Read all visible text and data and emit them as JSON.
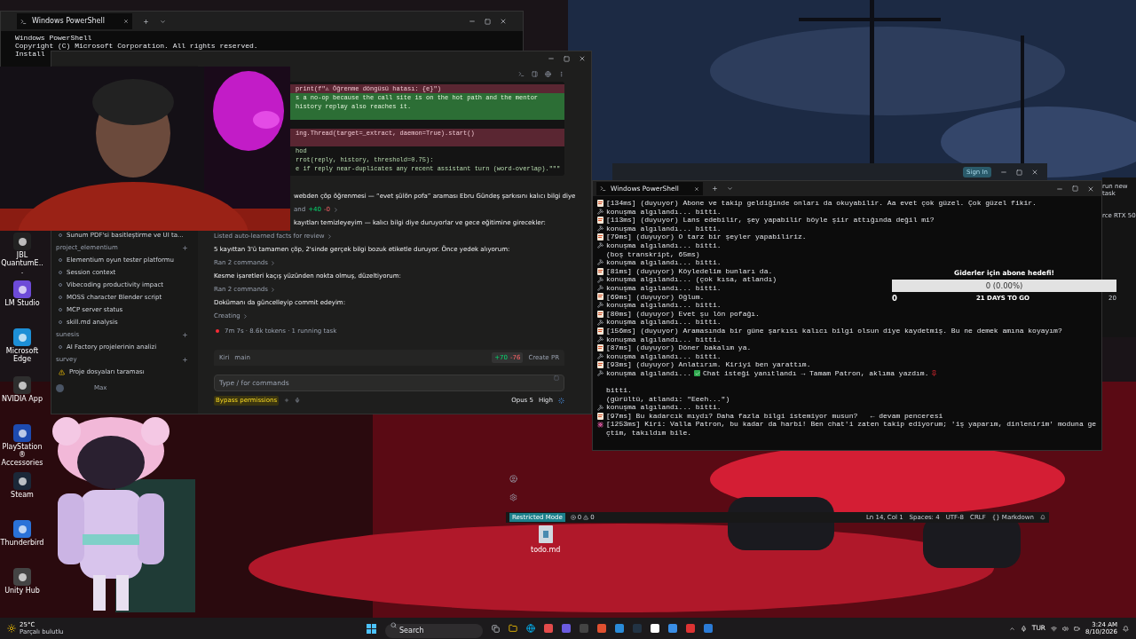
{
  "desktop_icons": [
    {
      "label": "JBL QuantumE...",
      "kind": "headset"
    },
    {
      "label": "LM Studio",
      "kind": "lm"
    },
    {
      "label": "Microsoft Edge",
      "kind": "edge"
    },
    {
      "label": "NVIDIA App",
      "kind": "nvidia"
    },
    {
      "label": "PlayStation® Accessories",
      "kind": "ps"
    },
    {
      "label": "Steam",
      "kind": "steam"
    },
    {
      "label": "Thunderbird",
      "kind": "bird"
    },
    {
      "label": "Unity Hub",
      "kind": "unity"
    }
  ],
  "desktop_file": {
    "label": "todo.md"
  },
  "back_terminal": {
    "tab": "Windows PowerShell",
    "lines": [
      "Windows PowerShell",
      "Copyright (C) Microsoft Corporation. All rights reserved.",
      "Install"
    ]
  },
  "agent_app": {
    "sidebar": {
      "groups": [
        {
          "items": [
            {
              "label": "Sunum PDF'si basitleştirme ve UI ta...",
              "kind": "chat"
            }
          ]
        },
        {
          "name": "project_elementium",
          "items": [
            {
              "label": "Elementium oyun tester platformu",
              "kind": "chat"
            },
            {
              "label": "Session context",
              "kind": "chat"
            },
            {
              "label": "Vibecoding productivity impact",
              "kind": "chat"
            },
            {
              "label": "MOSS character Blender script",
              "kind": "chat"
            },
            {
              "label": "MCP server status",
              "kind": "chat"
            },
            {
              "label": "skill.md analysis",
              "kind": "chat"
            }
          ]
        },
        {
          "name": "sunesis",
          "items": [
            {
              "label": "AI Factory projelerinin analizi",
              "kind": "chat"
            }
          ]
        },
        {
          "name": "survey",
          "items": [
            {
              "label": "Proje dosyaları taraması",
              "kind": "warning"
            }
          ]
        }
      ],
      "plan": "Max"
    },
    "diff": [
      {
        "kind": "removed",
        "text": "print(f\"⚠ Öğrenme döngüsü hatası: {e}\")"
      },
      {
        "kind": "added",
        "text": "s a no-op because the call site is on the hot path and the mentor"
      },
      {
        "kind": "added",
        "text": "history replay also reaches it."
      },
      {
        "kind": "added"
      },
      {
        "kind": "context"
      },
      {
        "kind": "removed",
        "text": "ing.Thread(target=_extract, daemon=True).start()"
      },
      {
        "kind": "removed"
      },
      {
        "kind": "context",
        "text": "hod"
      },
      {
        "kind": "context",
        "text": "rrot(reply, history, threshold=0.75):"
      },
      {
        "kind": "context",
        "text": "e if reply near-duplicates any recent assistant turn (word-overlap).\"\"\""
      }
    ],
    "messages_cut": [
      {
        "kind": "text",
        "text": "webden çöp öğrenmesi — “evet şülön pofa” araması Ebru Gündeş şarkısını kalıcı bilgi diye"
      },
      {
        "kind": "edit",
        "text": "and",
        "added": "+40",
        "removed": "-0"
      },
      {
        "kind": "text",
        "text": "kayıtları temizleyeyim — kalıcı bilgi diye duruyorlar ve gece eğitimine girecekler:"
      }
    ],
    "messages": [
      {
        "kind": "link",
        "text": "Listed auto-learned facts for review"
      },
      {
        "kind": "text",
        "text": "5 kayıttan 3'ü tamamen çöp, 2'sinde gerçek bilgi bozuk etiketle duruyor. Önce yedek alıyorum:"
      },
      {
        "kind": "link",
        "text": "Ran 2 commands"
      },
      {
        "kind": "text",
        "text": "Kesme işaretleri kaçış yüzünden nokta olmuş, düzeltiyorum:"
      },
      {
        "kind": "link",
        "text": "Ran 2 commands"
      },
      {
        "kind": "text",
        "text": "Dokümanı da güncelleyip commit edeyim:"
      },
      {
        "kind": "link",
        "text": "Creating"
      }
    ],
    "status": "7m 7s · 8.6k tokens · 1 running task",
    "branch_bar": {
      "agent": "Kiri",
      "branch": "main",
      "added": "+70",
      "removed": "-76",
      "action": "Create PR"
    },
    "input": {
      "placeholder": "Type / for commands"
    },
    "mode": "Bypass permissions",
    "model": "Opus 5",
    "effort": "High"
  },
  "terminal": {
    "tab": "Windows PowerShell",
    "lines": [
      {
        "kind": "note",
        "text": "[134ms] (duyuyor) Abone ve takip geldiğinde onları da okuyabilir. Aa evet çok güzel. Çok güzel fikir."
      },
      {
        "kind": "pick",
        "text": "konuşma algılandı... bitti."
      },
      {
        "kind": "note",
        "text": "[113ms] (duyuyor) Lans edebilir, şey yapabilir böyle şiir attığında değil mi?"
      },
      {
        "kind": "pick",
        "text": "konuşma algılandı... bitti."
      },
      {
        "kind": "note",
        "text": "[79ms] (duyuyor) O tarz bir şeyler yapabiliriz."
      },
      {
        "kind": "pick",
        "text": "konuşma algılandı... bitti."
      },
      {
        "kind": "plain",
        "text": "(boş transkript, 65ms)"
      },
      {
        "kind": "pick",
        "text": "konuşma algılandı... bitti."
      },
      {
        "kind": "note",
        "text": "[81ms] (duyuyor) Köyledelim bunları da."
      },
      {
        "kind": "pick",
        "text": "konuşma algılandı... (çok kısa, atlandı)"
      },
      {
        "kind": "pick",
        "text": "konuşma algılandı... bitti."
      },
      {
        "kind": "note",
        "text": "[69ms] (duyuyor) Oğlum."
      },
      {
        "kind": "pick",
        "text": "konuşma algılandı... bitti."
      },
      {
        "kind": "note",
        "text": "[80ms] (duyuyor) Evet şu lön pofağı."
      },
      {
        "kind": "pick",
        "text": "konuşma algılandı... bitti."
      },
      {
        "kind": "note",
        "text": "[156ms] (duyuyor) Aramasında bir güne şarkısı kalıcı bilgi olsun diye kaydetmiş. Bu ne demek amına koyayım?"
      },
      {
        "kind": "pick",
        "text": "konuşma algılandı... bitti."
      },
      {
        "kind": "note",
        "text": "[87ms] (duyuyor) Döner bakalım ya."
      },
      {
        "kind": "pick",
        "text": "konuşma algılandı... bitti."
      },
      {
        "kind": "note",
        "text": "[93ms] (duyuyor) Anlatırım. Kiriyi ben yarattım."
      },
      {
        "kind": "reply",
        "text": "konuşma algılandı...",
        "reply": "Chat isteği yanıtlandı → Tamam Patron, aklıma yazdım."
      },
      {
        "kind": "blank"
      },
      {
        "kind": "plain",
        "text": "bitti."
      },
      {
        "kind": "plain",
        "text": "(gürültü, atlandı: \"Eeeh...\")"
      },
      {
        "kind": "pick",
        "text": "konuşma algılandı... bitti."
      },
      {
        "kind": "note",
        "text": "[97ms] Bu kadarcık mıydı? Daha fazla bilgi istemiyor musun?   ← devam penceresi"
      },
      {
        "kind": "kiri",
        "text": "[1253ms] Kiri: Valla Patron, bu kadar da harbi! Ben chat'i zaten takip ediyorum; 'iş yaparım, dinlenirim' moduna geçtim, takıldım bile."
      }
    ]
  },
  "sub_goal": {
    "title": "Giderler için abone hedefi!",
    "reading": "0 (0.00%)",
    "level": 0,
    "start": "0",
    "end": "20",
    "days": "21 DAYS TO GO"
  },
  "back_window": {
    "button": "Sign In"
  },
  "side_window": {
    "button": "run new task",
    "gpu": "rce RTX 50"
  },
  "editor_status": {
    "mode": "Restricted Mode",
    "errors": "0",
    "warnings": "0",
    "items": [
      "Ln 14, Col 1",
      "Spaces: 4",
      "UTF-8",
      "CRLF",
      "{} Markdown"
    ]
  },
  "taskbar": {
    "temp": "25°C",
    "weather": "Parçalı bulutlu",
    "search": {
      "placeholder": "Search"
    },
    "lang": "TUR",
    "time": "3:24 AM",
    "date": "8/10/2026"
  }
}
